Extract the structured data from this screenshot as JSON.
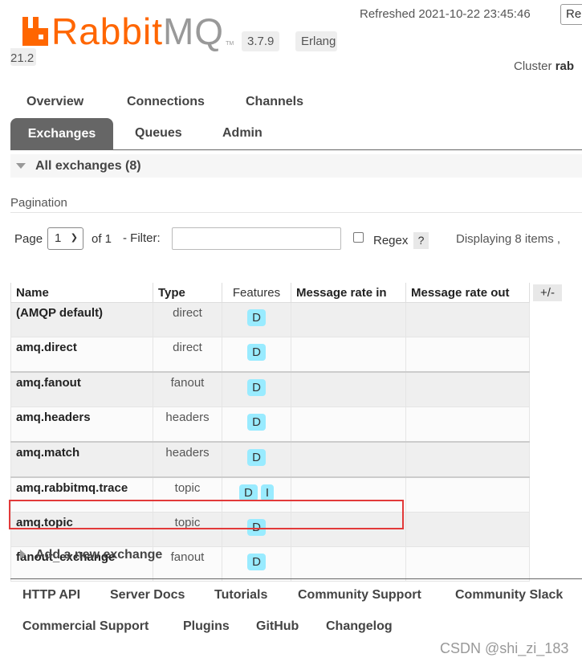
{
  "header": {
    "brand_part1": "Rabbit",
    "brand_part2": "MQ",
    "trademark": "TM",
    "version": "3.7.9",
    "erlang_label": "Erlang",
    "erlang_version": "21.2",
    "refreshed": "Refreshed 2021-10-22 23:45:46",
    "refresh_select_value": "Re",
    "cluster_label": "Cluster",
    "cluster_name": "rab"
  },
  "nav": {
    "tabs_row1": [
      "Overview",
      "Connections",
      "Channels"
    ],
    "tabs_row2_active": "Exchanges",
    "tabs_row2": [
      "Queues",
      "Admin"
    ]
  },
  "section": {
    "title": "All exchanges (8)"
  },
  "pagination": {
    "title": "Pagination",
    "page_label": "Page",
    "page_value": "1",
    "of_label": "of 1",
    "filter_label": "- Filter:",
    "filter_value": "",
    "regex_label": "Regex",
    "help_label": "?",
    "displaying": "Displaying 8 items ,"
  },
  "table": {
    "columns": [
      "Name",
      "Type",
      "Features",
      "Message rate in",
      "Message rate out"
    ],
    "plus_minus": "+/-",
    "rows": [
      {
        "name": "(AMQP default)",
        "type": "direct",
        "features": [
          "D"
        ]
      },
      {
        "name": "amq.direct",
        "type": "direct",
        "features": [
          "D"
        ]
      },
      {
        "name": "amq.fanout",
        "type": "fanout",
        "features": [
          "D"
        ]
      },
      {
        "name": "amq.headers",
        "type": "headers",
        "features": [
          "D"
        ]
      },
      {
        "name": "amq.match",
        "type": "headers",
        "features": [
          "D"
        ]
      },
      {
        "name": "amq.rabbitmq.trace",
        "type": "topic",
        "features": [
          "D",
          "I"
        ]
      },
      {
        "name": "amq.topic",
        "type": "topic",
        "features": [
          "D"
        ]
      },
      {
        "name": "fanout_exchange",
        "type": "fanout",
        "features": [
          "D"
        ]
      }
    ]
  },
  "add_exchange_label": "Add a new exchange",
  "footer": {
    "row1": [
      "HTTP API",
      "Server Docs",
      "Tutorials",
      "Community Support",
      "Community Slack"
    ],
    "row2": [
      "Commercial Support",
      "Plugins",
      "GitHub",
      "Changelog"
    ]
  },
  "watermark": "CSDN @shi_zi_183",
  "colors": {
    "brand_orange": "#ff6600",
    "active_tab": "#666666",
    "feature_badge": "#99ebff",
    "highlight_border": "#e23a3a"
  }
}
